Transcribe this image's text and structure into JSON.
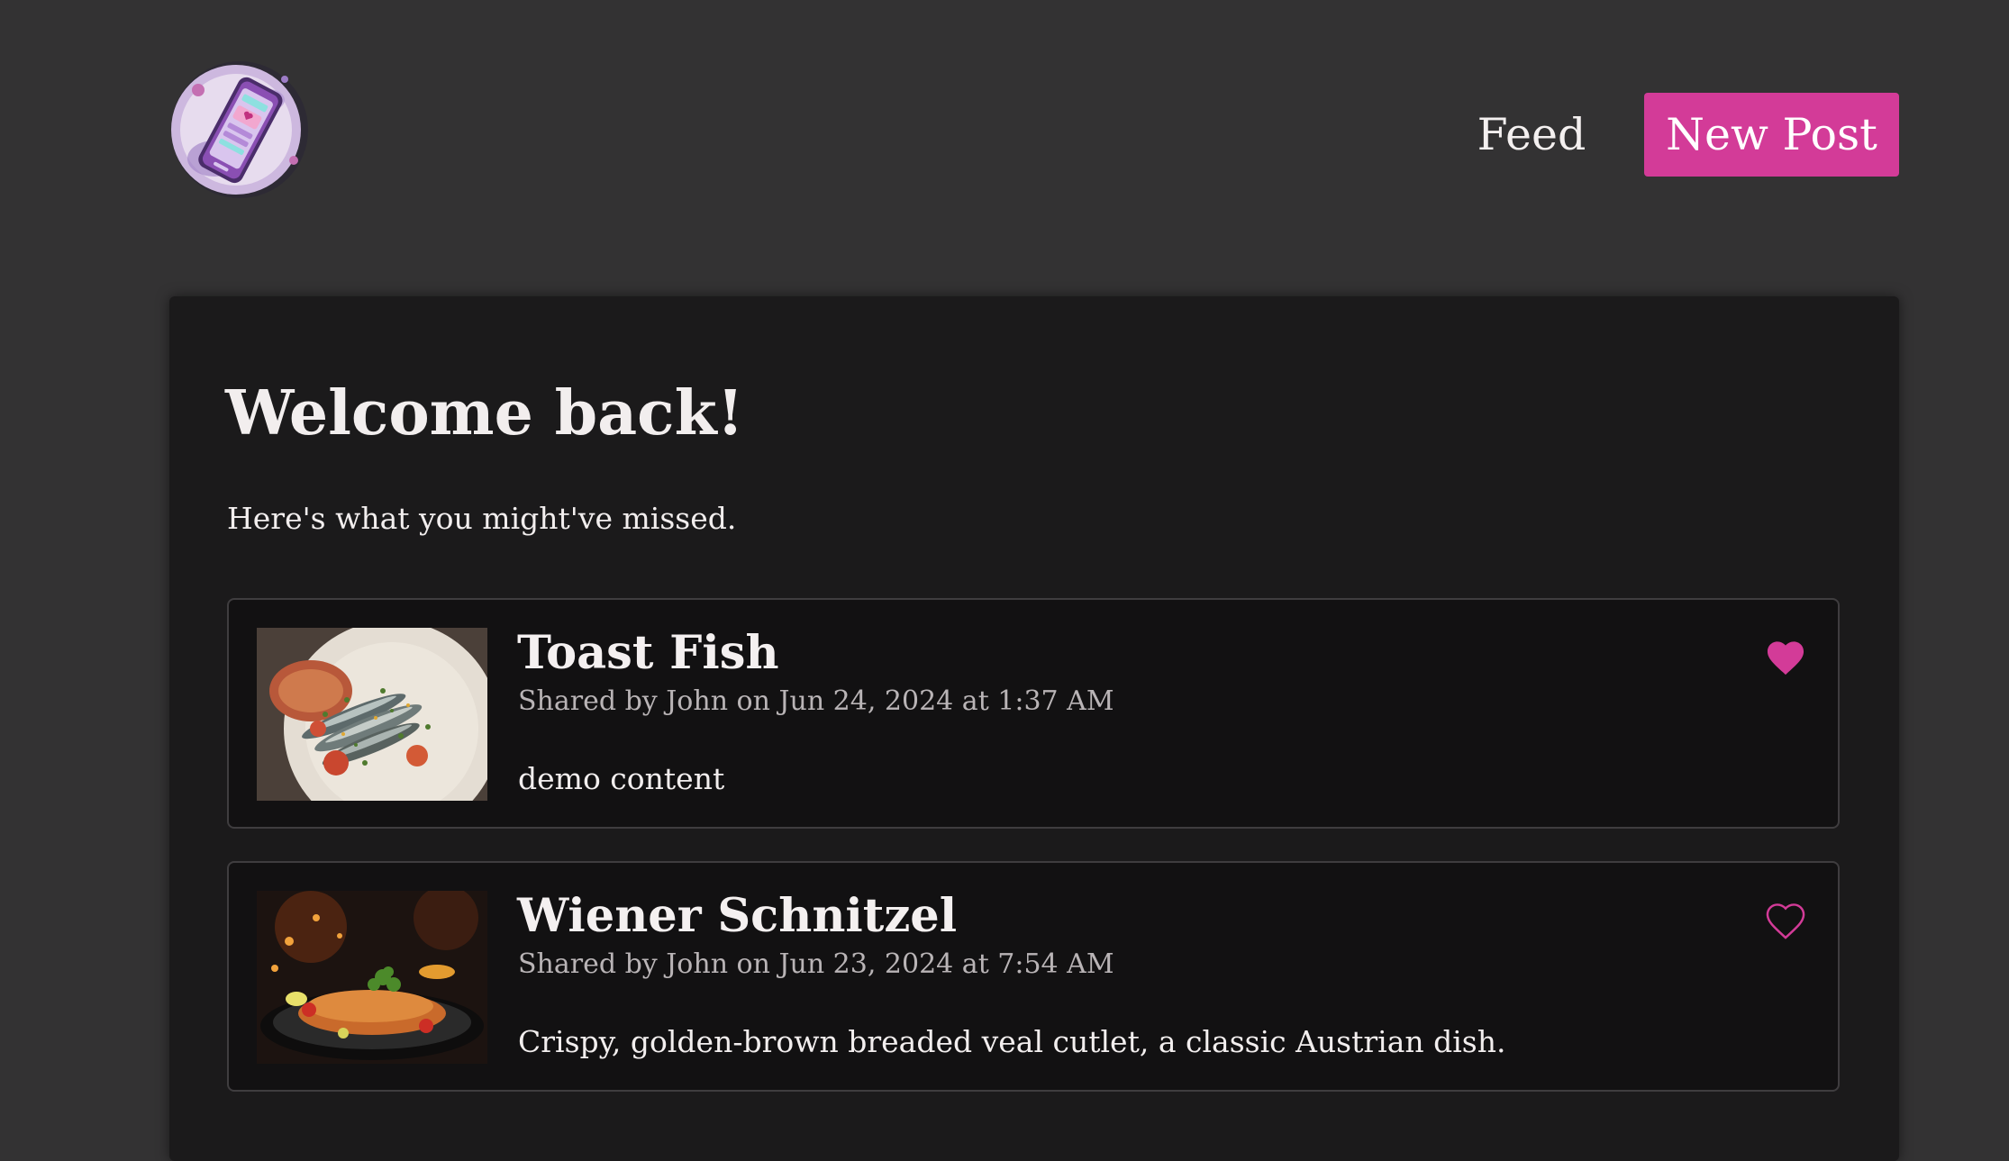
{
  "app": {
    "logo_icon": "phone-app-logo-icon",
    "accent_color": "#d33b98"
  },
  "nav": {
    "feed_label": "Feed",
    "new_post_label": "New Post"
  },
  "welcome": {
    "title": "Welcome back!",
    "subtitle": "Here's what you might've missed."
  },
  "posts": [
    {
      "title": "Toast Fish",
      "meta": "Shared by John on Jun 24, 2024 at 1:37 AM",
      "body": "demo content",
      "liked": true,
      "image_icon": "sardines-on-toast-photo"
    },
    {
      "title": "Wiener Schnitzel",
      "meta": "Shared by John on Jun 23, 2024 at 7:54 AM",
      "body": "Crispy, golden-brown breaded veal cutlet, a classic Austrian dish.",
      "liked": false,
      "image_icon": "schnitzel-plate-photo"
    }
  ]
}
